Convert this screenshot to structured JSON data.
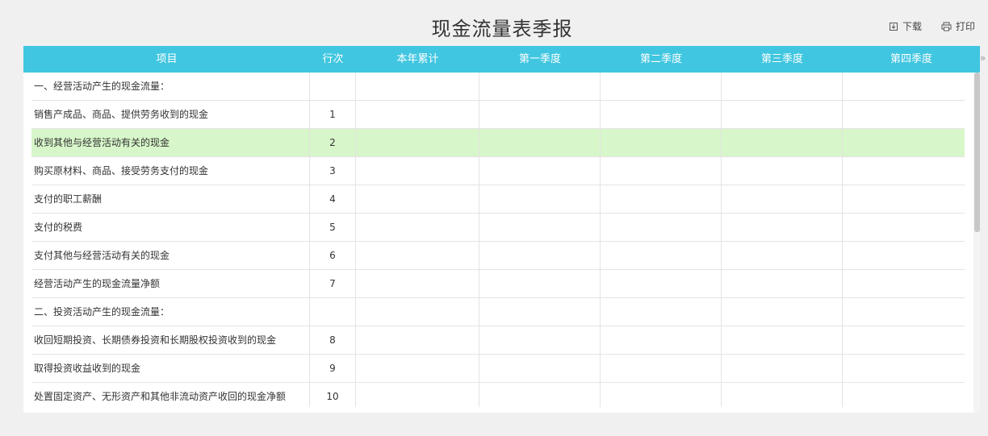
{
  "page": {
    "title": "现金流量表季报"
  },
  "actions": {
    "download_label": "下载",
    "print_label": "打印"
  },
  "table": {
    "headers": [
      "项目",
      "行次",
      "本年累计",
      "第一季度",
      "第二季度",
      "第三季度",
      "第四季度"
    ],
    "rows": [
      {
        "item": "一、经营活动产生的现金流量：",
        "line": "",
        "values": [
          "",
          "",
          "",
          "",
          ""
        ]
      },
      {
        "item": "销售产成品、商品、提供劳务收到的现金",
        "line": "1",
        "values": [
          "",
          "",
          "",
          "",
          ""
        ]
      },
      {
        "item": "收到其他与经营活动有关的现金",
        "line": "2",
        "values": [
          "",
          "",
          "",
          "",
          ""
        ]
      },
      {
        "item": "购买原材料、商品、接受劳务支付的现金",
        "line": "3",
        "values": [
          "",
          "",
          "",
          "",
          ""
        ]
      },
      {
        "item": "支付的职工薪酬",
        "line": "4",
        "values": [
          "",
          "",
          "",
          "",
          ""
        ]
      },
      {
        "item": "支付的税费",
        "line": "5",
        "values": [
          "",
          "",
          "",
          "",
          ""
        ]
      },
      {
        "item": "支付其他与经营活动有关的现金",
        "line": "6",
        "values": [
          "",
          "",
          "",
          "",
          ""
        ]
      },
      {
        "item": "经营活动产生的现金流量净额",
        "line": "7",
        "values": [
          "",
          "",
          "",
          "",
          ""
        ]
      },
      {
        "item": "二、投资活动产生的现金流量：",
        "line": "",
        "values": [
          "",
          "",
          "",
          "",
          ""
        ]
      },
      {
        "item": "收回短期投资、长期债券投资和长期股权投资收到的现金",
        "line": "8",
        "values": [
          "",
          "",
          "",
          "",
          ""
        ]
      },
      {
        "item": "取得投资收益收到的现金",
        "line": "9",
        "values": [
          "",
          "",
          "",
          "",
          ""
        ]
      },
      {
        "item": "处置固定资产、无形资产和其他非流动资产收回的现金净额",
        "line": "10",
        "values": [
          "",
          "",
          "",
          "",
          ""
        ]
      }
    ],
    "highlighted_row_index": 2
  },
  "colors": {
    "header_bg": "#40c6e0",
    "highlight_bg": "#d7f6c9",
    "border": "#e4e4e4"
  },
  "icons": {
    "download": "download-icon",
    "print": "printer-icon",
    "expand": "double-chevron-right-icon"
  }
}
